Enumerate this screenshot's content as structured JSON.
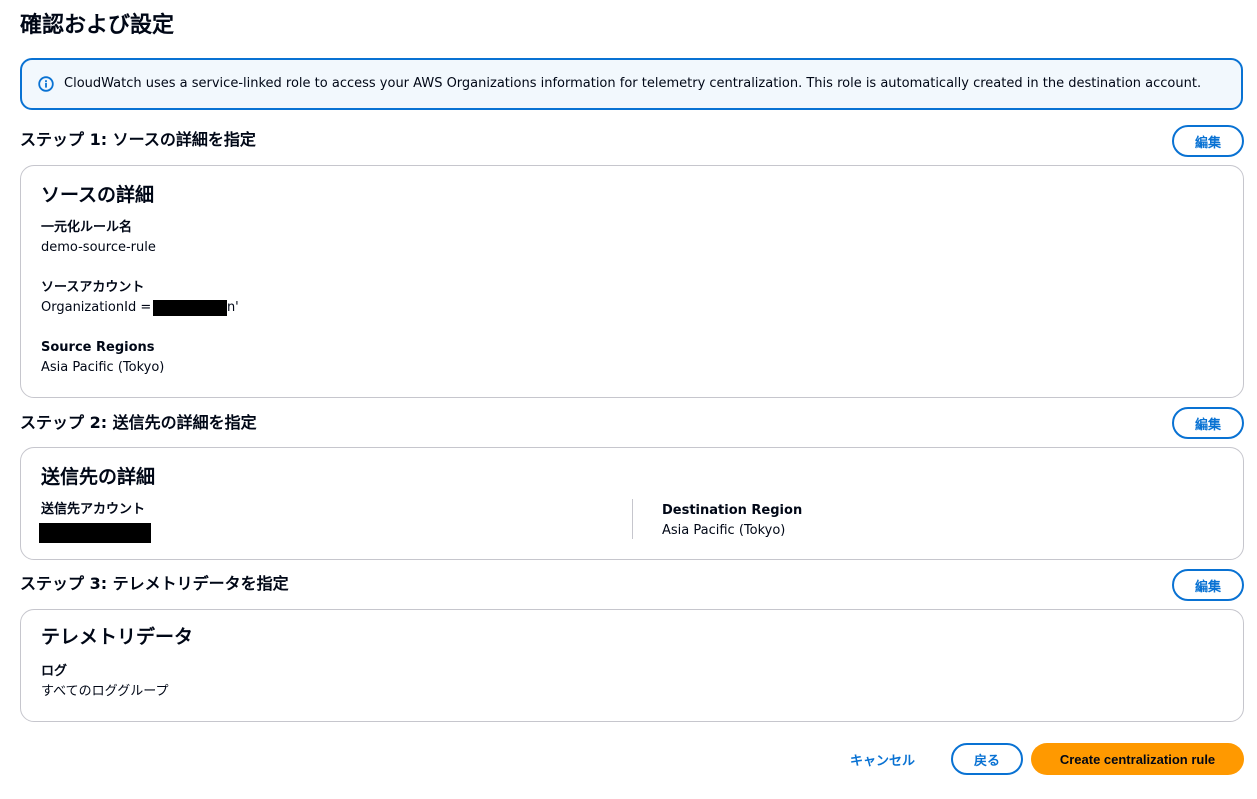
{
  "page": {
    "title": "確認および設定"
  },
  "info_banner": {
    "text": "CloudWatch uses a service-linked role to access your AWS Organizations information for telemetry centralization. This role is automatically created in the destination account.",
    "icon": "info-icon"
  },
  "edit_label": "編集",
  "step1": {
    "heading": "ステップ 1: ソースの詳細を指定",
    "card_title": "ソースの詳細",
    "rule_name_label": "一元化ルール名",
    "rule_name_value": "demo-source-rule",
    "source_account_label": "ソースアカウント",
    "source_account_prefix": "OrganizationId = '",
    "source_account_suffix": "n'",
    "source_regions_label": "Source Regions",
    "source_regions_value": "Asia Pacific (Tokyo)"
  },
  "step2": {
    "heading": "ステップ 2: 送信先の詳細を指定",
    "card_title": "送信先の詳細",
    "dest_account_label": "送信先アカウント",
    "dest_region_label": "Destination Region",
    "dest_region_value": "Asia Pacific (Tokyo)"
  },
  "step3": {
    "heading": "ステップ 3: テレメトリデータを指定",
    "card_title": "テレメトリデータ",
    "logs_label": "ログ",
    "logs_value": "すべてのロググループ"
  },
  "footer": {
    "cancel_label": "キャンセル",
    "back_label": "戻る",
    "create_label": "Create centralization rule"
  },
  "colors": {
    "accent": "#0972d3",
    "primary_button": "#ff9900",
    "banner_bg": "#f2f8fd"
  }
}
